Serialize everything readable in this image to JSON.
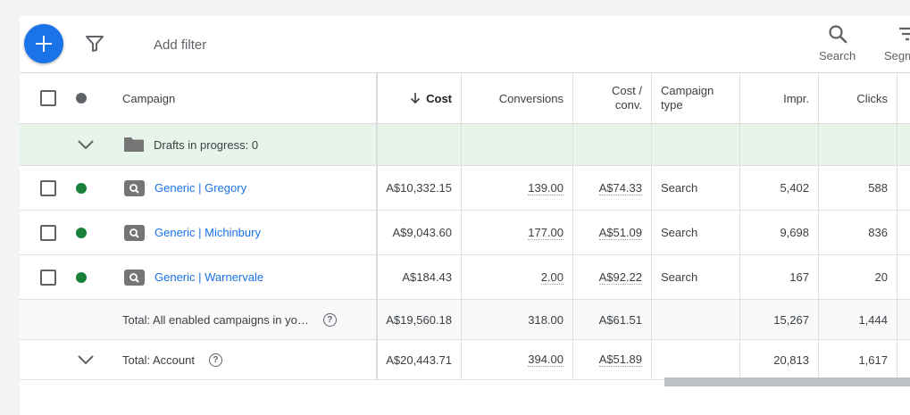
{
  "toolbar": {
    "add_filter": "Add filter",
    "search_label": "Search",
    "segment_label": "Segment"
  },
  "colors": {
    "accent": "#1a73e8",
    "enabled": "#188038",
    "draft_bg": "#e6f4ea",
    "status_header": "#5f6368"
  },
  "columns": {
    "campaign": "Campaign",
    "cost": "Cost",
    "conversions": "Conversions",
    "cost_conv_line1": "Cost /",
    "cost_conv_line2": "conv.",
    "type_line1": "Campaign",
    "type_line2": "type",
    "impr": "Impr.",
    "clicks": "Clicks"
  },
  "drafts": {
    "label": "Drafts in progress: 0"
  },
  "campaigns": [
    {
      "name": "Generic | Gregory",
      "cost": "A$10,332.15",
      "conversions": "139.00",
      "cost_conv": "A$74.33",
      "type": "Search",
      "impr": "5,402",
      "clicks": "588"
    },
    {
      "name": "Generic | Michinbury",
      "cost": "A$9,043.60",
      "conversions": "177.00",
      "cost_conv": "A$51.09",
      "type": "Search",
      "impr": "9,698",
      "clicks": "836"
    },
    {
      "name": "Generic | Warnervale",
      "cost": "A$184.43",
      "conversions": "2.00",
      "cost_conv": "A$92.22",
      "type": "Search",
      "impr": "167",
      "clicks": "20"
    }
  ],
  "total_enabled": {
    "label": "Total: All enabled campaigns in yo…",
    "cost": "A$19,560.18",
    "conversions": "318.00",
    "cost_conv": "A$61.51",
    "impr": "15,267",
    "clicks": "1,444"
  },
  "total_account": {
    "label": "Total: Account",
    "cost": "A$20,443.71",
    "conversions": "394.00",
    "cost_conv": "A$51.89",
    "impr": "20,813",
    "clicks": "1,617"
  },
  "help_glyph": "?"
}
